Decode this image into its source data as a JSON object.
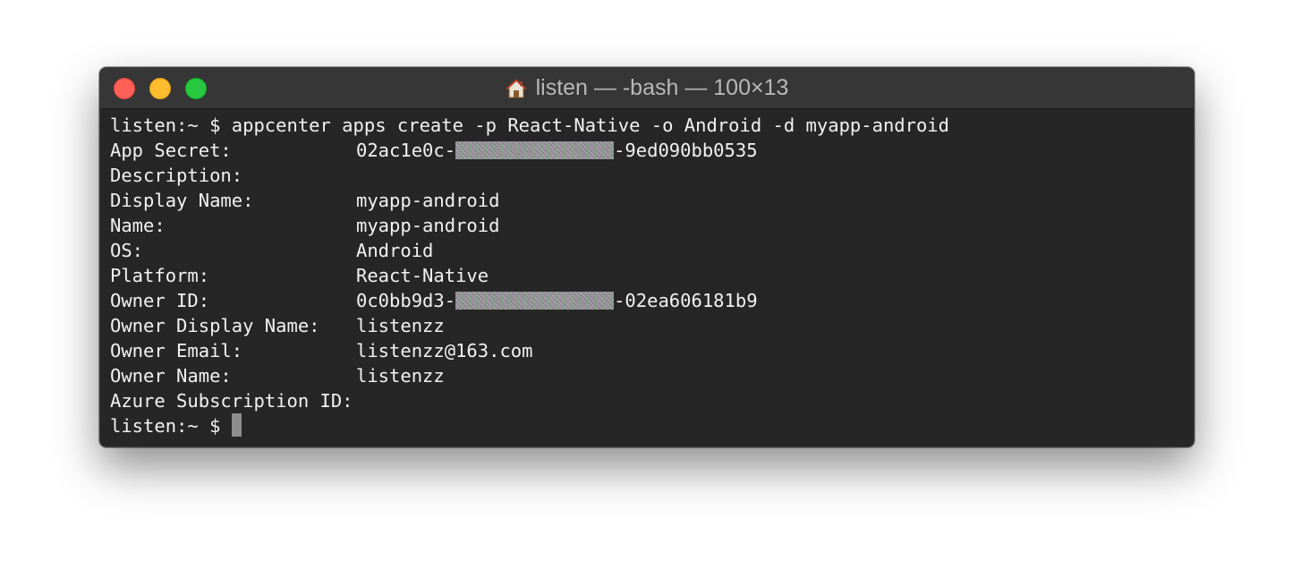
{
  "window": {
    "title": "listen — -bash — 100×13",
    "icon": "home-icon"
  },
  "terminal": {
    "command_line": "listen:~ $ appcenter apps create -p React-Native -o Android -d myapp-android",
    "fields": [
      {
        "key": "App Secret:",
        "prefix": "02ac1e0c-",
        "suffix": "-9ed090bb0535"
      },
      {
        "key": "Description:",
        "value": ""
      },
      {
        "key": "Display Name:",
        "value": "myapp-android"
      },
      {
        "key": "Name:",
        "value": "myapp-android"
      },
      {
        "key": "OS:",
        "value": "Android"
      },
      {
        "key": "Platform:",
        "value": "React-Native"
      },
      {
        "key": "Owner ID:",
        "prefix": "0c0bb9d3-",
        "suffix": "-02ea606181b9"
      },
      {
        "key": "Owner Display Name:",
        "value": "listenzz"
      },
      {
        "key": "Owner Email:",
        "value": "listenzz@163.com"
      },
      {
        "key": "Owner Name:",
        "value": "listenzz"
      },
      {
        "key": "Azure Subscription ID:",
        "value": ""
      }
    ],
    "prompt": "listen:~ $ "
  }
}
